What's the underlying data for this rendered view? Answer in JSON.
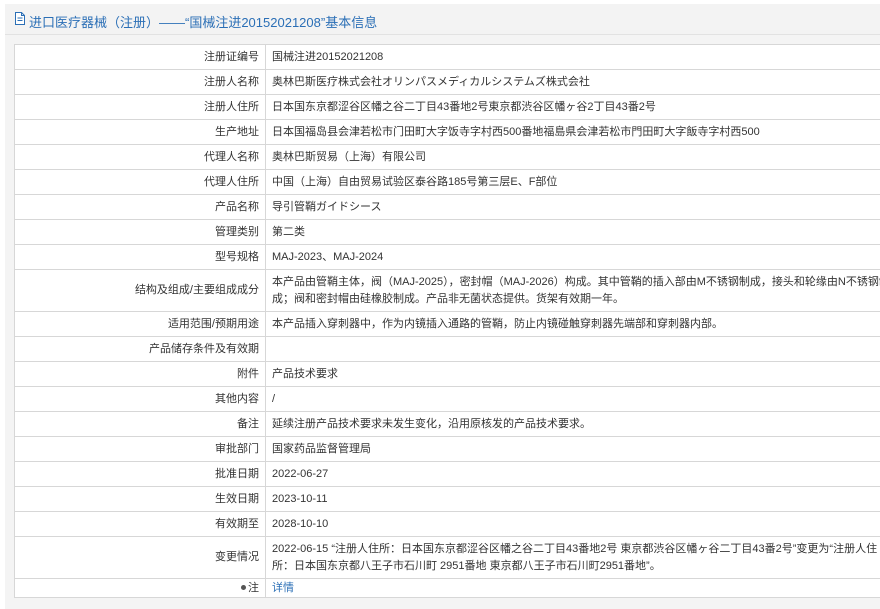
{
  "header": {
    "title": "进口医疗器械（注册）——“国械注进20152021208”基本信息"
  },
  "rows": [
    {
      "label": "注册证编号",
      "value": "国械注进20152021208"
    },
    {
      "label": "注册人名称",
      "value": "奥林巴斯医疗株式会社オリンパスメディカルシステムズ株式会社"
    },
    {
      "label": "注册人住所",
      "value": "日本国东京都涩谷区幡之谷二丁目43番地2号東京都渋谷区幡ヶ谷2丁目43番2号"
    },
    {
      "label": "生产地址",
      "value": "日本国福岛县会津若松市门田町大字饭寺字村西500番地福島県会津若松市門田町大字飯寺字村西500"
    },
    {
      "label": "代理人名称",
      "value": "奥林巴斯贸易（上海）有限公司"
    },
    {
      "label": "代理人住所",
      "value": "中国（上海）自由贸易试验区泰谷路185号第三层E、F部位"
    },
    {
      "label": "产品名称",
      "value": "导引管鞘ガイドシース"
    },
    {
      "label": "管理类别",
      "value": "第二类"
    },
    {
      "label": "型号规格",
      "value": "MAJ-2023、MAJ-2024"
    },
    {
      "label": "结构及组成/主要组成成分",
      "value": "本产品由管鞘主体，阀（MAJ-2025），密封帽（MAJ-2026）构成。其中管鞘的插入部由M不锈钢制成，接头和轮缘由N不锈钢制成；阀和密封帽由硅橡胶制成。产品非无菌状态提供。货架有效期一年。"
    },
    {
      "label": "适用范围/预期用途",
      "value": "本产品插入穿刺器中，作为内镜插入通路的管鞘，防止内镜碰触穿刺器先端部和穿刺器内部。"
    },
    {
      "label": "产品储存条件及有效期",
      "value": ""
    },
    {
      "label": "附件",
      "value": "产品技术要求"
    },
    {
      "label": "其他内容",
      "value": "/"
    },
    {
      "label": "备注",
      "value": "延续注册产品技术要求未发生变化，沿用原核发的产品技术要求。"
    },
    {
      "label": "审批部门",
      "value": "国家药品监督管理局"
    },
    {
      "label": "批准日期",
      "value": "2022-06-27"
    },
    {
      "label": "生效日期",
      "value": "2023-10-11"
    },
    {
      "label": "有效期至",
      "value": "2028-10-10"
    },
    {
      "label": "变更情况",
      "value": "2022-06-15 “注册人住所：日本国东京都涩谷区幡之谷二丁目43番地2号 東京都渋谷区幡ヶ谷二丁目43番2号”变更为“注册人住所：日本国东京都八王子市石川町 2951番地 東京都八王子市石川町2951番地”。"
    }
  ],
  "note_row": {
    "label": "注",
    "link": "详情"
  }
}
